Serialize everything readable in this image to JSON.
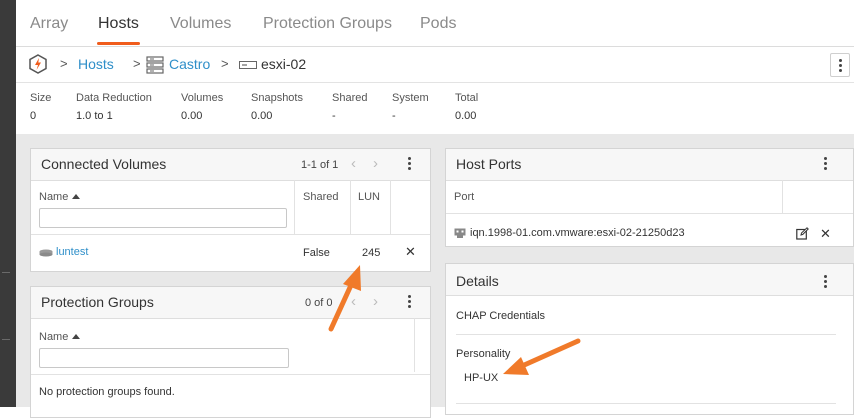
{
  "tabs": [
    {
      "label": "Array"
    },
    {
      "label": "Hosts"
    },
    {
      "label": "Volumes"
    },
    {
      "label": "Protection Groups"
    },
    {
      "label": "Pods"
    }
  ],
  "breadcrumb": {
    "hosts": "Hosts",
    "host_group": "Castro",
    "host": "esxi-02",
    "separator": ">"
  },
  "stats": [
    {
      "label": "Size",
      "value": "0"
    },
    {
      "label": "Data Reduction",
      "value": "1.0 to 1"
    },
    {
      "label": "Volumes",
      "value": "0.00"
    },
    {
      "label": "Snapshots",
      "value": "0.00"
    },
    {
      "label": "Shared",
      "value": "-"
    },
    {
      "label": "System",
      "value": "-"
    },
    {
      "label": "Total",
      "value": "0.00"
    }
  ],
  "connected_volumes": {
    "title": "Connected Volumes",
    "pager": "1-1 of 1",
    "columns": {
      "name": "Name",
      "shared": "Shared",
      "lun": "LUN"
    },
    "rows": [
      {
        "name": "luntest",
        "shared": "False",
        "lun": "245"
      }
    ]
  },
  "protection_groups": {
    "title": "Protection Groups",
    "pager": "0 of 0",
    "columns": {
      "name": "Name"
    },
    "empty_message": "No protection groups found."
  },
  "host_ports": {
    "title": "Host Ports",
    "columns": {
      "port": "Port"
    },
    "rows": [
      {
        "port": "iqn.1998-01.com.vmware:esxi-02-21250d23"
      }
    ]
  },
  "details": {
    "title": "Details",
    "chap_label": "CHAP Credentials",
    "personality_label": "Personality",
    "personality_value": "HP-UX"
  },
  "colors": {
    "accent": "#f05c1c",
    "link": "#2f8fc9",
    "annotation_arrow": "#f07a2a"
  }
}
